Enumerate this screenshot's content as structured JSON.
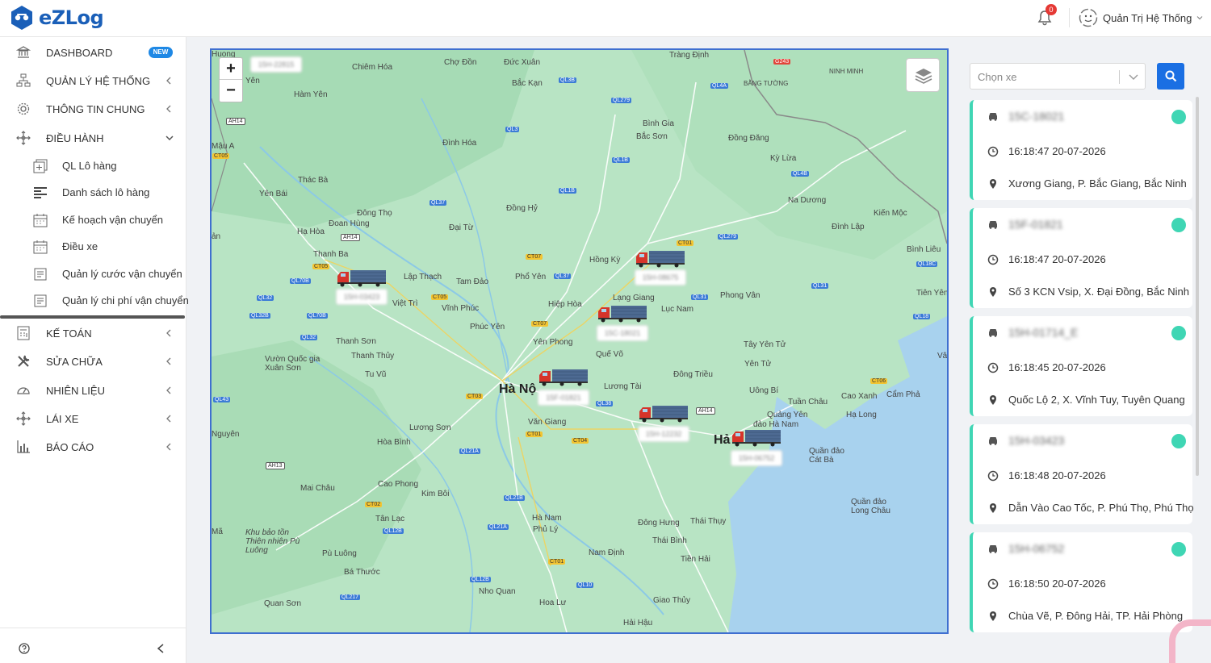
{
  "app": {
    "name": "eZLog"
  },
  "header": {
    "notification_count": "0",
    "user_name": "Quản Trị Hệ Thống"
  },
  "sidebar": {
    "items": [
      {
        "label": "DASHBOARD",
        "icon": "bank-icon",
        "badge": "NEW"
      },
      {
        "label": "QUẢN LÝ HỆ THỐNG",
        "icon": "hierarchy-icon"
      },
      {
        "label": "THÔNG TIN CHUNG",
        "icon": "gear-icon"
      },
      {
        "label": "ĐIỀU HÀNH",
        "icon": "move-icon",
        "expanded": true
      },
      {
        "label": "KẾ TOÁN",
        "icon": "calculator-icon"
      },
      {
        "label": "SỬA CHỮA",
        "icon": "tools-icon"
      },
      {
        "label": "NHIÊN LIỆU",
        "icon": "gauge-icon"
      },
      {
        "label": "LÁI XE",
        "icon": "steering-icon"
      },
      {
        "label": "BÁO CÁO",
        "icon": "bar-chart-icon"
      }
    ],
    "sub_items": [
      {
        "label": "QL Lô hàng",
        "icon": "add-doc-icon"
      },
      {
        "label": "Danh sách lô hàng",
        "icon": "list-icon"
      },
      {
        "label": "Kế hoạch vận chuyển",
        "icon": "calendar-icon"
      },
      {
        "label": "Điều xe",
        "icon": "calendar-icon"
      },
      {
        "label": "Quản lý cước vận chuyển",
        "icon": "document-icon"
      },
      {
        "label": "Quản lý chi phí vận chuyển",
        "icon": "document-icon"
      }
    ]
  },
  "map": {
    "cities": [
      "Hà Nộ",
      "Hả"
    ],
    "labels": [
      "Chiêm Hóa",
      "Chợ Đồn",
      "Đức Xuân",
      "Tràng Định",
      "Bắc Kạn",
      "Hàm Yên",
      "Đình Hóa",
      "Bình Gia",
      "Bắc Sơn",
      "Đồng Đăng",
      "Kỳ Lừa",
      "Na Dương",
      "Kiến Mộc",
      "Đình Lập",
      "Thác Bà",
      "Yên Bái",
      "Đông Thọ",
      "Đoan Hùng",
      "Hạ Hòa",
      "Đồng Hỷ",
      "Đại Từ",
      "Thanh Ba",
      "Lập Thạch",
      "Tam Đảo",
      "Phổ Yên",
      "Hồng Kỳ",
      "Việt Trì",
      "Vĩnh Phúc",
      "Hiệp Hòa",
      "Phúc Yên",
      "Lạng Giang",
      "Lục Nam",
      "Phong Vân",
      "Yên Phong",
      "Quế Võ",
      "Tây Yên Tử",
      "Thanh Sơn",
      "Thanh Thủy",
      "Tu Vũ",
      "Vườn Quốc gia Xuân Sơn",
      "Đông Triều",
      "Yên Tử",
      "Lương Tài",
      "Uông Bí",
      "Tuần Châu",
      "Cao Xanh",
      "Cẩm Phả",
      "Hạ Long",
      "Văn Giang",
      "Lương Sơn",
      "Hòa Bình",
      "Quảng Yên",
      "đảo Hà Nam",
      "Quần đảo Cát Bà",
      "Mai Châu",
      "Cao Phong",
      "Kim Bôi",
      "Tân Lạc",
      "Hà Nam",
      "Phủ Lý",
      "Quần đảo Long Châu",
      "Đông Hưng",
      "Thái Thụy",
      "Thái Bình",
      "Khu bảo tồn Thiên nhiên Pù Luông",
      "Pù Luông",
      "Nam Định",
      "Tiền Hải",
      "Bá Thước",
      "Nho Quan",
      "Giao Thủy",
      "Quan Sơn",
      "Hoa Lư",
      "Hải Hậu",
      "NINH MINH",
      "BẰNG TƯỜNG",
      "Bình Liêu",
      "Tiên Yên",
      "Mậu A",
      "Yên",
      "Nguyên",
      "Mã",
      "ản",
      "Vân",
      "Huong"
    ],
    "roads": [
      "QL3B",
      "QL4A",
      "QL279",
      "QL3",
      "QL1B",
      "QL1B",
      "QL4B",
      "QL37",
      "CT07",
      "CT01",
      "QL279",
      "QL18C",
      "CT05",
      "QL70B",
      "AH14",
      "QL37",
      "CT05",
      "QL31",
      "QL31",
      "QL32",
      "QL32B",
      "QL70B",
      "CT07",
      "QL18",
      "QL32",
      "QL43",
      "CT03",
      "QL38",
      "AH14",
      "CT06",
      "CT01",
      "CT04",
      "QL21A",
      "AH13",
      "CT02",
      "QL21B",
      "QL12B",
      "QL21A",
      "CT01",
      "QL10",
      "QL12B",
      "QL217",
      "AH14",
      "CT05",
      "G243"
    ]
  },
  "vehicle_panel": {
    "select_placeholder": "Chọn xe",
    "vehicles": [
      {
        "plate": "15C-18021",
        "time": "16:18:47 20-07-2026",
        "address": "Xương Giang, P. Bắc Giang, Bắc Ninh"
      },
      {
        "plate": "15F-01821",
        "time": "16:18:47 20-07-2026",
        "address": "Số 3 KCN Vsip, X. Đại Đồng, Bắc Ninh"
      },
      {
        "plate": "15H-01714_E",
        "time": "16:18:45 20-07-2026",
        "address": "Quốc Lộ 2, X. Vĩnh Tuy, Tuyên Quang"
      },
      {
        "plate": "15H-03423",
        "time": "16:18:48 20-07-2026",
        "address": "Dẫn Vào Cao Tốc, P. Phú Thọ, Phú Thọ"
      },
      {
        "plate": "15H-06752",
        "time": "16:18:50 20-07-2026",
        "address": "Chùa Vẽ, P. Đông Hải, TP. Hải Phòng"
      }
    ],
    "map_plates": [
      "15H-22815",
      "15H-03423",
      "15H-08675",
      "15C-18021",
      "15F-01821",
      "15H-12232",
      "15H-06752"
    ]
  }
}
